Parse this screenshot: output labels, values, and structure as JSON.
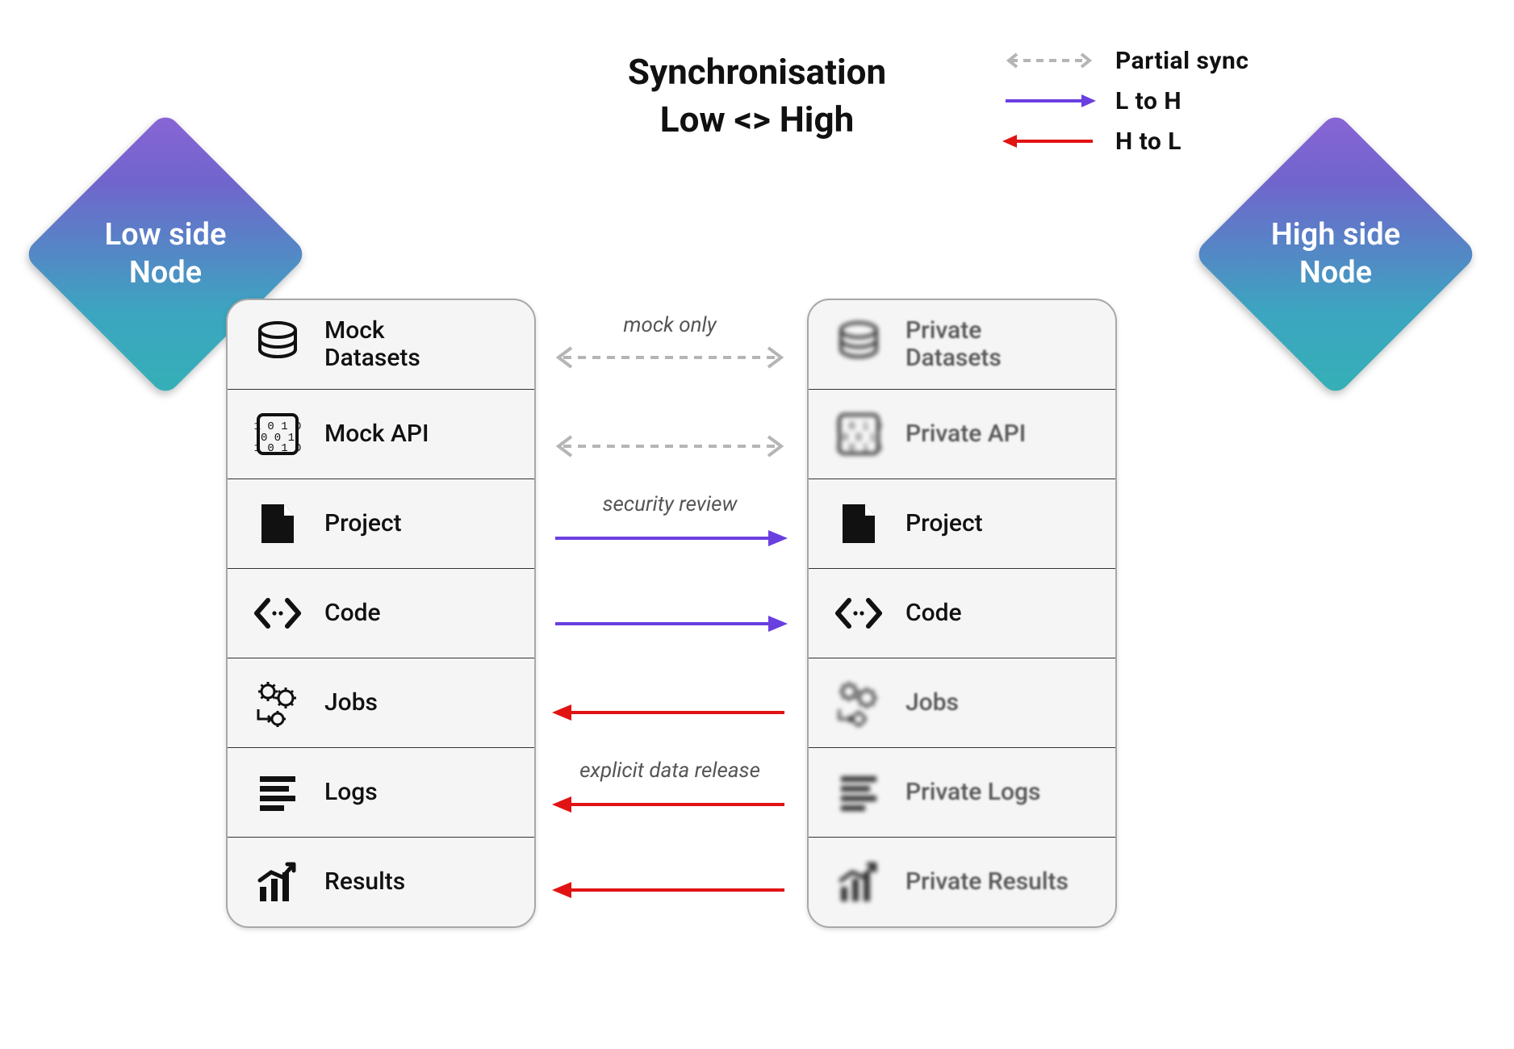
{
  "title_line1": "Synchronisation",
  "title_line2": "Low <> High",
  "legend": {
    "partial": "Partial sync",
    "l_to_h": "L to H",
    "h_to_l": "H to L"
  },
  "diamonds": {
    "low": "Low side\nNode",
    "high": "High side\nNode"
  },
  "low_panel": {
    "datasets": "Mock\nDatasets",
    "api": "Mock API",
    "project": "Project",
    "code": "Code",
    "jobs": "Jobs",
    "logs": "Logs",
    "results": "Results"
  },
  "high_panel": {
    "datasets": "Private\nDatasets",
    "api": "Private API",
    "project": "Project",
    "code": "Code",
    "jobs": "Jobs",
    "logs": "Private Logs",
    "results": "Private Results"
  },
  "captions": {
    "mock_only": "mock only",
    "security_review": "security review",
    "explicit_release": "explicit data release"
  },
  "colors": {
    "partial": "#b5b5b5",
    "l_to_h": "#6a3fe0",
    "h_to_l": "#e11313"
  }
}
